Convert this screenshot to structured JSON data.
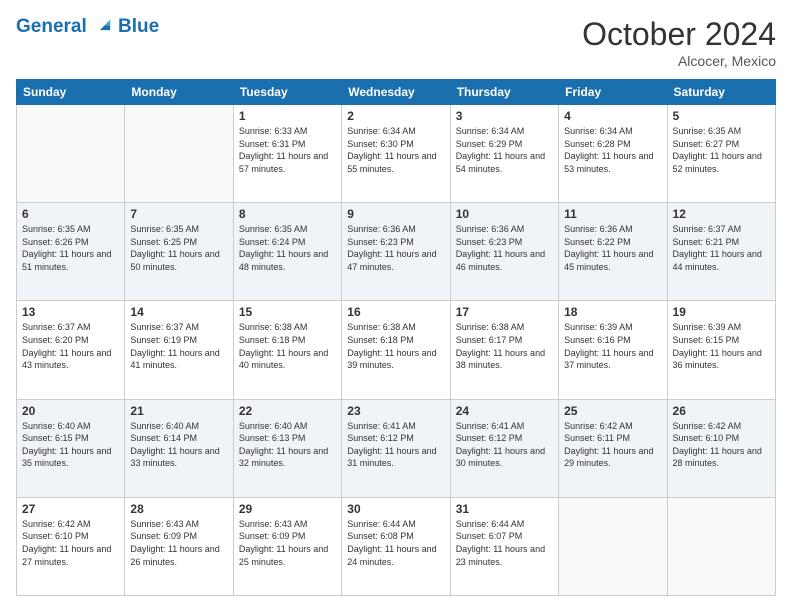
{
  "header": {
    "logo_line1": "General",
    "logo_line2": "Blue",
    "month_title": "October 2024",
    "location": "Alcocer, Mexico"
  },
  "weekdays": [
    "Sunday",
    "Monday",
    "Tuesday",
    "Wednesday",
    "Thursday",
    "Friday",
    "Saturday"
  ],
  "weeks": [
    [
      {
        "day": "",
        "info": ""
      },
      {
        "day": "",
        "info": ""
      },
      {
        "day": "1",
        "info": "Sunrise: 6:33 AM\nSunset: 6:31 PM\nDaylight: 11 hours and 57 minutes."
      },
      {
        "day": "2",
        "info": "Sunrise: 6:34 AM\nSunset: 6:30 PM\nDaylight: 11 hours and 55 minutes."
      },
      {
        "day": "3",
        "info": "Sunrise: 6:34 AM\nSunset: 6:29 PM\nDaylight: 11 hours and 54 minutes."
      },
      {
        "day": "4",
        "info": "Sunrise: 6:34 AM\nSunset: 6:28 PM\nDaylight: 11 hours and 53 minutes."
      },
      {
        "day": "5",
        "info": "Sunrise: 6:35 AM\nSunset: 6:27 PM\nDaylight: 11 hours and 52 minutes."
      }
    ],
    [
      {
        "day": "6",
        "info": "Sunrise: 6:35 AM\nSunset: 6:26 PM\nDaylight: 11 hours and 51 minutes."
      },
      {
        "day": "7",
        "info": "Sunrise: 6:35 AM\nSunset: 6:25 PM\nDaylight: 11 hours and 50 minutes."
      },
      {
        "day": "8",
        "info": "Sunrise: 6:35 AM\nSunset: 6:24 PM\nDaylight: 11 hours and 48 minutes."
      },
      {
        "day": "9",
        "info": "Sunrise: 6:36 AM\nSunset: 6:23 PM\nDaylight: 11 hours and 47 minutes."
      },
      {
        "day": "10",
        "info": "Sunrise: 6:36 AM\nSunset: 6:23 PM\nDaylight: 11 hours and 46 minutes."
      },
      {
        "day": "11",
        "info": "Sunrise: 6:36 AM\nSunset: 6:22 PM\nDaylight: 11 hours and 45 minutes."
      },
      {
        "day": "12",
        "info": "Sunrise: 6:37 AM\nSunset: 6:21 PM\nDaylight: 11 hours and 44 minutes."
      }
    ],
    [
      {
        "day": "13",
        "info": "Sunrise: 6:37 AM\nSunset: 6:20 PM\nDaylight: 11 hours and 43 minutes."
      },
      {
        "day": "14",
        "info": "Sunrise: 6:37 AM\nSunset: 6:19 PM\nDaylight: 11 hours and 41 minutes."
      },
      {
        "day": "15",
        "info": "Sunrise: 6:38 AM\nSunset: 6:18 PM\nDaylight: 11 hours and 40 minutes."
      },
      {
        "day": "16",
        "info": "Sunrise: 6:38 AM\nSunset: 6:18 PM\nDaylight: 11 hours and 39 minutes."
      },
      {
        "day": "17",
        "info": "Sunrise: 6:38 AM\nSunset: 6:17 PM\nDaylight: 11 hours and 38 minutes."
      },
      {
        "day": "18",
        "info": "Sunrise: 6:39 AM\nSunset: 6:16 PM\nDaylight: 11 hours and 37 minutes."
      },
      {
        "day": "19",
        "info": "Sunrise: 6:39 AM\nSunset: 6:15 PM\nDaylight: 11 hours and 36 minutes."
      }
    ],
    [
      {
        "day": "20",
        "info": "Sunrise: 6:40 AM\nSunset: 6:15 PM\nDaylight: 11 hours and 35 minutes."
      },
      {
        "day": "21",
        "info": "Sunrise: 6:40 AM\nSunset: 6:14 PM\nDaylight: 11 hours and 33 minutes."
      },
      {
        "day": "22",
        "info": "Sunrise: 6:40 AM\nSunset: 6:13 PM\nDaylight: 11 hours and 32 minutes."
      },
      {
        "day": "23",
        "info": "Sunrise: 6:41 AM\nSunset: 6:12 PM\nDaylight: 11 hours and 31 minutes."
      },
      {
        "day": "24",
        "info": "Sunrise: 6:41 AM\nSunset: 6:12 PM\nDaylight: 11 hours and 30 minutes."
      },
      {
        "day": "25",
        "info": "Sunrise: 6:42 AM\nSunset: 6:11 PM\nDaylight: 11 hours and 29 minutes."
      },
      {
        "day": "26",
        "info": "Sunrise: 6:42 AM\nSunset: 6:10 PM\nDaylight: 11 hours and 28 minutes."
      }
    ],
    [
      {
        "day": "27",
        "info": "Sunrise: 6:42 AM\nSunset: 6:10 PM\nDaylight: 11 hours and 27 minutes."
      },
      {
        "day": "28",
        "info": "Sunrise: 6:43 AM\nSunset: 6:09 PM\nDaylight: 11 hours and 26 minutes."
      },
      {
        "day": "29",
        "info": "Sunrise: 6:43 AM\nSunset: 6:09 PM\nDaylight: 11 hours and 25 minutes."
      },
      {
        "day": "30",
        "info": "Sunrise: 6:44 AM\nSunset: 6:08 PM\nDaylight: 11 hours and 24 minutes."
      },
      {
        "day": "31",
        "info": "Sunrise: 6:44 AM\nSunset: 6:07 PM\nDaylight: 11 hours and 23 minutes."
      },
      {
        "day": "",
        "info": ""
      },
      {
        "day": "",
        "info": ""
      }
    ]
  ]
}
